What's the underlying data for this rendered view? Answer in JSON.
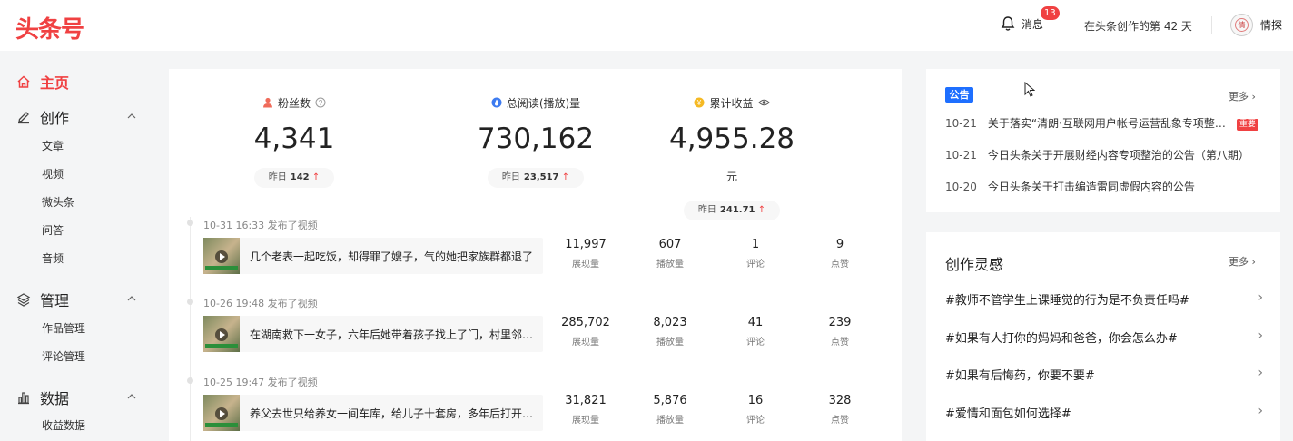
{
  "header": {
    "logo": "头条号",
    "messages_label": "消息",
    "messages_count": "13",
    "days_text": "在头条创作的第 42 天",
    "avatar_char": "情",
    "username": "情探"
  },
  "sidebar": {
    "home": "主页",
    "groups": [
      {
        "label": "创作",
        "items": [
          "文章",
          "视频",
          "微头条",
          "问答",
          "音频"
        ]
      },
      {
        "label": "管理",
        "items": [
          "作品管理",
          "评论管理"
        ]
      },
      {
        "label": "数据",
        "items": [
          "收益数据"
        ]
      }
    ]
  },
  "stats": [
    {
      "label": "粉丝数",
      "value": "4,341",
      "unit": "",
      "yesterday_label": "昨日",
      "yesterday_value": "142"
    },
    {
      "label": "总阅读(播放)量",
      "value": "730,162",
      "unit": "",
      "yesterday_label": "昨日",
      "yesterday_value": "23,517"
    },
    {
      "label": "累计收益",
      "value": "4,955.28",
      "unit": "元",
      "yesterday_label": "昨日",
      "yesterday_value": "241.71"
    }
  ],
  "posts": [
    {
      "time": "10-31 16:33",
      "action": "发布了视频",
      "title": "几个老表一起吃饭，却得罪了嫂子，气的她把家族群都退了",
      "impressions": "11,997",
      "plays": "607",
      "comments": "1",
      "likes": "9"
    },
    {
      "time": "10-26 19:48",
      "action": "发布了视频",
      "title": "在湖南救下一女子，六年后她带着孩子找上了门，村里邻居议论纷纷",
      "impressions": "285,702",
      "plays": "8,023",
      "comments": "41",
      "likes": "239"
    },
    {
      "time": "10-25 19:47",
      "action": "发布了视频",
      "title": "养父去世只给养女一间车库，给儿子十套房，多年后打开车库门",
      "impressions": "31,821",
      "plays": "5,876",
      "comments": "16",
      "likes": "328"
    }
  ],
  "metric_labels": {
    "impressions": "展现量",
    "plays": "播放量",
    "comments": "评论",
    "likes": "点赞"
  },
  "notice": {
    "tag": "公告",
    "more": "更多",
    "items": [
      {
        "date": "10-21",
        "title": "关于落实“清朗·互联网用户帐号运营乱象专项整治行动”的公告",
        "hot": "重要"
      },
      {
        "date": "10-21",
        "title": "今日头条关于开展财经内容专项整治的公告（第八期）"
      },
      {
        "date": "10-20",
        "title": "今日头条关于打击编造雷同虚假内容的公告"
      }
    ]
  },
  "inspiration": {
    "title": "创作灵感",
    "more": "更多",
    "topics": [
      "#教师不管学生上课睡觉的行为是不负责任吗#",
      "#如果有人打你的妈妈和爸爸，你会怎么办#",
      "#如果有后悔药，你要不要#",
      "#爱情和面包如何选择#"
    ]
  },
  "colors": {
    "brand": "#f04142",
    "notice_tag": "#1e6fff",
    "panel_bg": "#ffffff",
    "page_bg": "#f4f5f6"
  }
}
